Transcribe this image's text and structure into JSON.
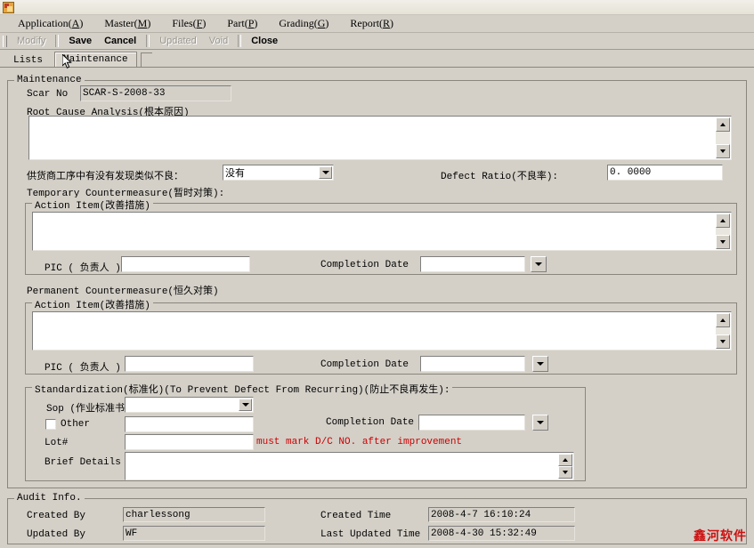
{
  "window": {
    "icon": "app-icon",
    "title": ""
  },
  "menubar": {
    "items": [
      {
        "label": "Application(A)",
        "text": "Application(",
        "key": "A",
        "tail": ")"
      },
      {
        "label": "Master(M)",
        "text": "Master(",
        "key": "M",
        "tail": ")"
      },
      {
        "label": "Files(F)",
        "text": "Files(",
        "key": "F",
        "tail": ")"
      },
      {
        "label": "Part(P)",
        "text": "Part(",
        "key": "P",
        "tail": ")"
      },
      {
        "label": "Grading(G)",
        "text": "Grading(",
        "key": "G",
        "tail": ")"
      },
      {
        "label": "Report(R)",
        "text": "Report(",
        "key": "R",
        "tail": ")"
      }
    ]
  },
  "toolbar": {
    "modify_label": "Modify",
    "save_label": "Save",
    "cancel_label": "Cancel",
    "updated_label": "Updated",
    "void_label": "Void",
    "close_label": "Close"
  },
  "tabs": [
    {
      "label": "Lists",
      "selected": false
    },
    {
      "label": "Maintenance",
      "selected": true
    }
  ],
  "maintenance": {
    "group_title": "Maintenance",
    "scar_no_label": "Scar No",
    "scar_no_value": "SCAR-S-2008-33",
    "root_cause_label": "Root Cause Analysis(根本原因)",
    "root_cause_value": "",
    "supplier_question_label": "供货商工序中有没有发现类似不良：",
    "supplier_answer_value": "没有",
    "defect_ratio_label": "Defect Ratio(不良率):",
    "defect_ratio_value": "0. 0000"
  },
  "temporary": {
    "section_label": "Temporary Countermeasure(暂时对策):",
    "action_item_title": "Action Item(改善措施)",
    "action_item_value": "",
    "pic_label": "PIC ( 负责人 )",
    "pic_value": "",
    "completion_date_label": "Completion Date",
    "completion_date_value": ""
  },
  "permanent": {
    "section_label": "Permanent Countermeasure(恒久对策)",
    "action_item_title": "Action Item(改善措施)",
    "action_item_value": "",
    "pic_label": "PIC ( 负责人 )",
    "pic_value": "",
    "completion_date_label": "Completion Date",
    "completion_date_value": ""
  },
  "standardization": {
    "group_title": "Standardization(标准化)(To Prevent Defect From Recurring)(防止不良再发生):",
    "sop_label": "Sop (作业标准书",
    "sop_value": "",
    "other_label": "Other",
    "other_checked": false,
    "other_value": "",
    "completion_date_label": "Completion Date",
    "completion_date_value": "",
    "lot_label": "Lot#",
    "lot_value": "",
    "warning_text": "must   mark D/C NO. after improvement",
    "warning_color": "#cc0000",
    "brief_details_label": "Brief Details",
    "brief_details_value": ""
  },
  "audit": {
    "group_title": "Audit Info.",
    "created_by_label": "Created By",
    "created_by_value": "charlessong",
    "updated_by_label": "Updated By",
    "updated_by_value": "WF",
    "created_time_label": "Created Time",
    "created_time_value": "2008-4-7 16:10:24",
    "last_updated_time_label": "Last Updated Time",
    "last_updated_time_value": "2008-4-30 15:32:49"
  },
  "watermark": {
    "text": "鑫河软件",
    "color": "#cc1111"
  }
}
